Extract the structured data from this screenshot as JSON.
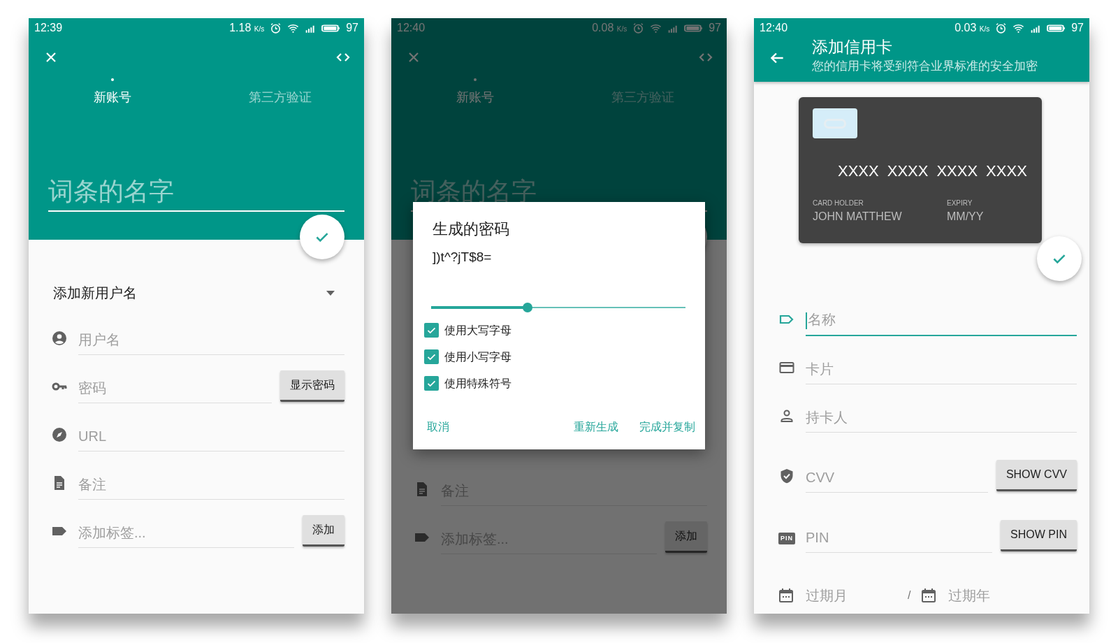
{
  "screens": [
    {
      "kind": "entry",
      "dimmed": false,
      "status_bar": {
        "time": "12:39",
        "speed": "1.18",
        "speed_unit": "K/s",
        "battery": "97"
      },
      "tabs": [
        {
          "label": "新账号",
          "selected": true
        },
        {
          "label": "第三方验证",
          "selected": false
        }
      ],
      "name_field": {
        "placeholder": "词条的名字"
      },
      "dropdown": {
        "label": "添加新用户名"
      },
      "fields": [
        {
          "kind": "account",
          "placeholder": "用户名"
        },
        {
          "kind": "key",
          "placeholder": "密码",
          "button": "显示密码"
        },
        {
          "kind": "compass",
          "placeholder": "URL"
        },
        {
          "kind": "note",
          "placeholder": "备注"
        },
        {
          "kind": "tag",
          "placeholder": "添加标签...",
          "button": "添加"
        }
      ]
    },
    {
      "kind": "entry",
      "dimmed": true,
      "status_bar": {
        "time": "12:40",
        "speed": "0.08",
        "speed_unit": "K/s",
        "battery": "97"
      },
      "tabs": [
        {
          "label": "新账号",
          "selected": true
        },
        {
          "label": "第三方验证",
          "selected": false
        }
      ],
      "name_field": {
        "placeholder": "词条的名字"
      },
      "fields": [
        {
          "kind": "note",
          "placeholder": "备注"
        },
        {
          "kind": "tag",
          "placeholder": "添加标签...",
          "button": "添加"
        }
      ],
      "dialog": {
        "title": "生成的密码",
        "password": "])t^?jT$8=",
        "length": {
          "level": 0.38
        },
        "options": [
          {
            "label": "使用大写字母",
            "checked": true
          },
          {
            "label": "使用小写字母",
            "checked": true
          },
          {
            "label": "使用特殊符号",
            "checked": true
          }
        ],
        "actions": [
          "取消",
          "重新生成",
          "完成并复制"
        ]
      }
    },
    {
      "kind": "card",
      "dimmed": false,
      "status_bar": {
        "time": "12:40",
        "speed": "0.03",
        "speed_unit": "K/s",
        "battery": "97"
      },
      "app_bar": {
        "title": "添加信用卡",
        "subtitle": "您的信用卡将受到符合业界标准的安全加密"
      },
      "card_preview": {
        "number_groups": [
          "XXXX",
          "XXXX",
          "XXXX",
          "XXXX"
        ],
        "holder_label": "CARD HOLDER",
        "holder": "JOHN MATTHEW",
        "expiry_label": "EXPIRY",
        "expiry": "MM/YY"
      },
      "fields": [
        {
          "kind": "label",
          "placeholder": "名称",
          "focused": true
        },
        {
          "kind": "card",
          "placeholder": "卡片",
          "focused": false
        },
        {
          "kind": "person",
          "placeholder": "持卡人",
          "focused": false
        },
        {
          "kind": "shield",
          "placeholder": "CVV",
          "focused": false,
          "button": "SHOW CVV"
        },
        {
          "kind": "pin",
          "icon_text": "PIN",
          "placeholder": "PIN",
          "focused": false,
          "button": "SHOW PIN"
        }
      ],
      "expiry": {
        "month_placeholder": "过期月",
        "separator": "/",
        "year_placeholder": "过期年"
      }
    }
  ]
}
